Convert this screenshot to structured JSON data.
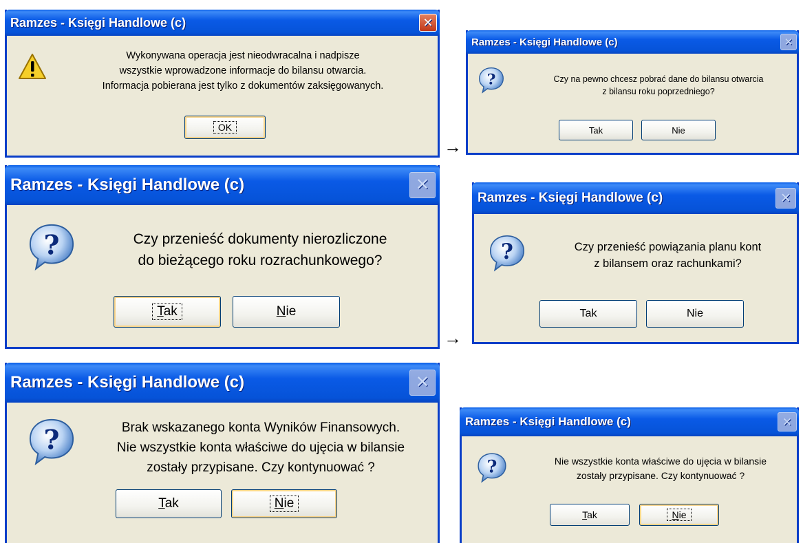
{
  "dialogs": {
    "d1": {
      "title": "Ramzes - Księgi Handlowe (c)",
      "message": [
        "Wykonywana operacja jest nieodwracalna i nadpisze",
        "wszystkie wprowadzone informacje do bilansu otwarcia.",
        "Informacja pobierana jest tylko z dokumentów zaksięgowanych."
      ],
      "ok": "OK",
      "icon": "warning-icon"
    },
    "d2": {
      "title": "Ramzes - Księgi Handlowe (c)",
      "message": [
        "Czy na pewno chcesz pobrać dane do bilansu otwarcia",
        "z bilansu roku poprzedniego?"
      ],
      "yes": "Tak",
      "no": "Nie",
      "icon": "question-icon"
    },
    "d3": {
      "title": "Ramzes - Księgi Handlowe (c)",
      "message": [
        "Czy przenieść dokumenty nierozliczone",
        "do bieżącego roku rozrachunkowego?"
      ],
      "yes": "Tak",
      "no": "Nie",
      "icon": "question-icon"
    },
    "d4": {
      "title": "Ramzes - Księgi Handlowe (c)",
      "message": [
        "Czy przenieść powiązania planu kont",
        "z bilansem oraz rachunkami?"
      ],
      "yes": "Tak",
      "no": "Nie",
      "icon": "question-icon"
    },
    "d5": {
      "title": "Ramzes - Księgi Handlowe (c)",
      "message": [
        "Brak wskazanego konta Wyników Finansowych.",
        "Nie wszystkie konta właściwe do ujęcia w bilansie",
        "zostały przypisane. Czy kontynuować ?"
      ],
      "yes": "Tak",
      "no": "Nie",
      "icon": "question-icon"
    },
    "d6": {
      "title": "Ramzes - Księgi Handlowe (c)",
      "message": [
        "Nie wszystkie konta właściwe do ujęcia w bilansie",
        "zostały przypisane. Czy kontynuować ?"
      ],
      "yes": "Tak",
      "no": "Nie",
      "icon": "question-icon"
    }
  },
  "arrows": [
    "→",
    "→"
  ],
  "colors": {
    "title_bar": "#0653d8",
    "dialog_bg": "#ece9d8",
    "close_active": "#c2391a"
  }
}
